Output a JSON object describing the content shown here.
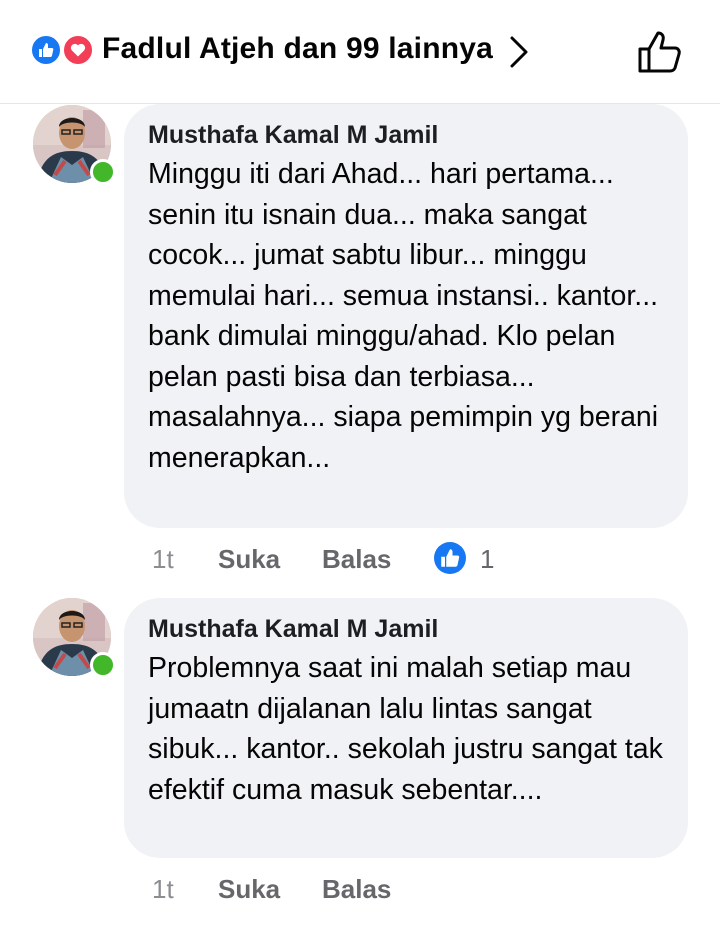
{
  "header": {
    "reaction_icons": [
      "like-icon",
      "love-icon"
    ],
    "title": "Fadlul Atjeh dan 99 lainnya"
  },
  "comments": [
    {
      "author": "Musthafa Kamal M Jamil",
      "text": "Minggu iti dari Ahad... hari pertama... senin itu isnain dua... maka sangat cocok... jumat sabtu libur... minggu memulai hari... semua instansi.. kantor... bank dimulai minggu/ahad.  Klo pelan pelan pasti bisa dan terbiasa... masalahnya... siapa pemimpin yg berani menerapkan...",
      "time": "1t",
      "like_label": "Suka",
      "reply_label": "Balas",
      "like_count": "1",
      "online": true
    },
    {
      "author": "Musthafa Kamal M Jamil",
      "text": "Problemnya saat ini malah setiap mau jumaatn dijalanan lalu lintas sangat sibuk... kantor.. sekolah justru sangat tak efektif cuma masuk sebentar....",
      "time": "1t",
      "like_label": "Suka",
      "reply_label": "Balas",
      "online": true
    }
  ],
  "colors": {
    "accent": "#1877f2",
    "love": "#f33e58",
    "online": "#42b72a",
    "bubble": "#f0f2f5",
    "secondary_text": "#65676b"
  }
}
